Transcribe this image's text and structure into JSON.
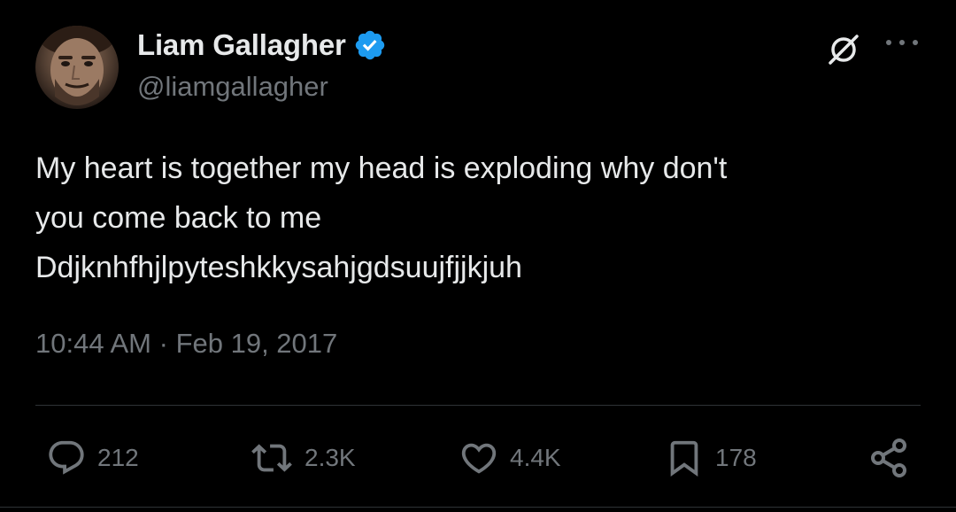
{
  "author": {
    "name": "Liam Gallagher",
    "handle": "@liamgallagher",
    "verified": true
  },
  "tweet": {
    "text": "My heart is together my head is exploding why don't\nyou come back to me\nDdjknhfhjlpyteshkkysahjgdsuujfjjkjuh",
    "time": "10:44 AM",
    "separator": "·",
    "date": "Feb 19, 2017"
  },
  "actions": {
    "replies": "212",
    "reposts": "2.3K",
    "likes": "4.4K",
    "bookmarks": "178"
  },
  "icons": {
    "verified": "verified-badge-icon",
    "grok": "grok-icon",
    "more": "more-icon",
    "reply": "reply-icon",
    "repost": "repost-icon",
    "like": "heart-icon",
    "bookmark": "bookmark-icon",
    "share": "share-icon"
  },
  "colors": {
    "background": "#000000",
    "text": "#e7e9ea",
    "secondary": "#71767b",
    "verified": "#1d9bf0",
    "divider": "#2f3336"
  }
}
